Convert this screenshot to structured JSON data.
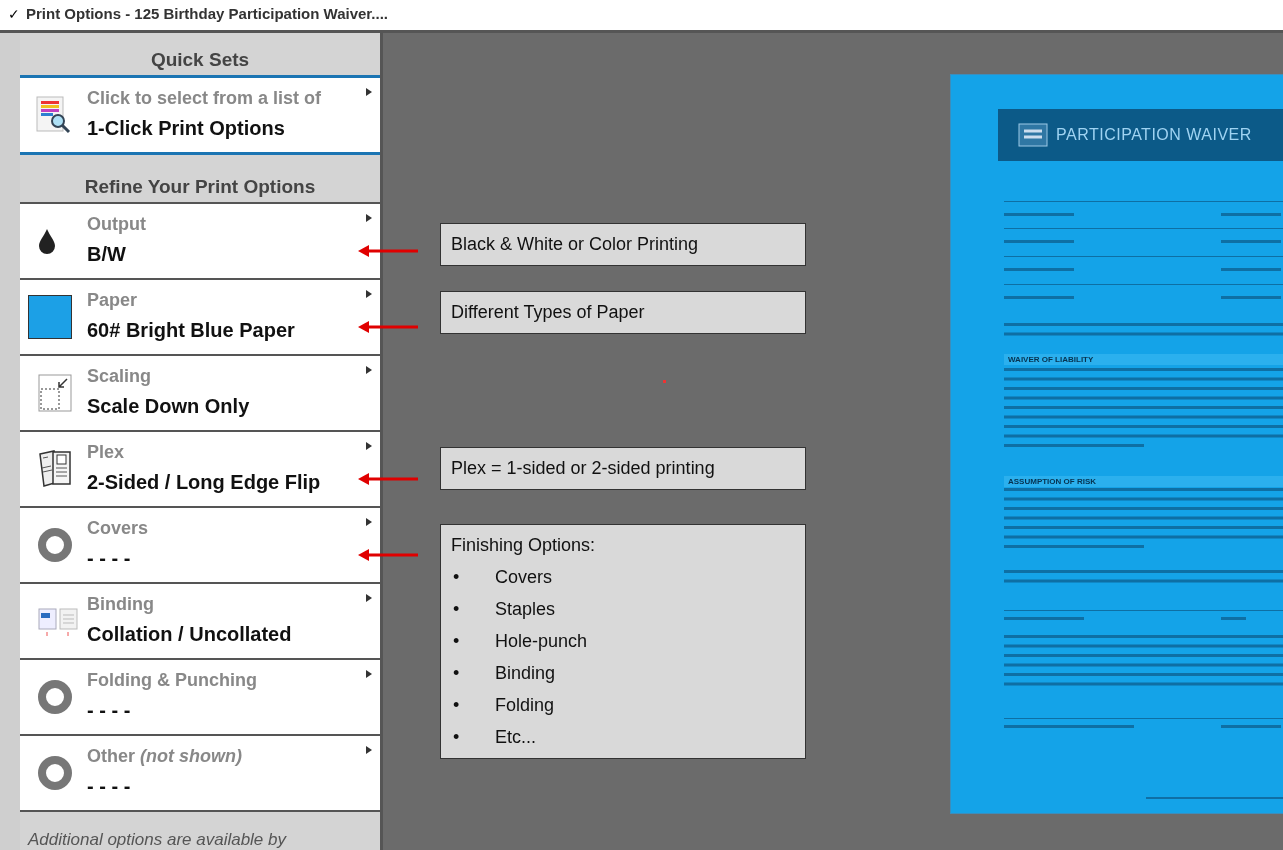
{
  "title_bar": {
    "check": "✓",
    "title": "Print Options - 125 Birthday Participation Waiver...."
  },
  "sidebar": {
    "quick_sets": {
      "heading": "Quick Sets",
      "line1": "Click to select from a list of",
      "line2": "1-Click Print Options"
    },
    "refine_heading": "Refine Your Print Options",
    "options": [
      {
        "kind": "drop",
        "label": "Output",
        "value": "B/W",
        "annotated": true
      },
      {
        "kind": "swatch",
        "label": "Paper",
        "value": "60# Bright Blue Paper",
        "color": "#1ca0e6",
        "annotated": true
      },
      {
        "kind": "scaling",
        "label": "Scaling",
        "value": "Scale Down Only",
        "annotated": false
      },
      {
        "kind": "plex",
        "label": "Plex",
        "value": "2-Sided / Long Edge Flip",
        "annotated": true
      },
      {
        "kind": "ring",
        "label": "Covers",
        "value": "- - - -",
        "annotated": true
      },
      {
        "kind": "binding",
        "label": "Binding",
        "value": "Collation / Uncollated",
        "annotated": false
      },
      {
        "kind": "ring",
        "label": "Folding & Punching",
        "value": "- - - -",
        "annotated": false
      },
      {
        "kind": "ring",
        "label": "Other *(not shown)*",
        "value": "- - - -",
        "annotated": false
      }
    ],
    "footer": "Additional options are available by"
  },
  "callouts": [
    {
      "kind": "note",
      "text": "Black & White or Color Printing"
    },
    {
      "kind": "note",
      "text": "Different Types of Paper"
    },
    {
      "kind": "note",
      "text": "Plex = 1-sided or 2-sided printing"
    },
    {
      "kind": "list",
      "heading": "Finishing Options:",
      "bullet": "•",
      "items": [
        "Covers",
        "Staples",
        "Hole-punch",
        "Binding",
        "Folding",
        "Etc..."
      ]
    }
  ],
  "preview": {
    "title": "PARTICIPATION WAIVER",
    "sections": [
      "WAIVER OF LIABILITY",
      "ASSUMPTION OF RISK"
    ]
  }
}
